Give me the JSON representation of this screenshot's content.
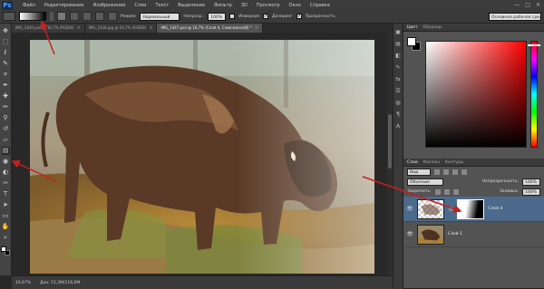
{
  "app": {
    "logo": "Ps"
  },
  "menu": [
    "Файл",
    "Редактирование",
    "Изображение",
    "Слои",
    "Текст",
    "Выделение",
    "Фильтр",
    "3D",
    "Просмотр",
    "Окно",
    "Справка"
  ],
  "window_buttons": [
    "—",
    "□",
    "✕"
  ],
  "options_bar": {
    "mode_label": "Режим:",
    "mode_value": "Нормальный",
    "opacity_label": "Непрозр.:",
    "opacity_value": "100%",
    "invert_label": "Инверсия",
    "dither_label": "Дизеринг",
    "transparency_label": "Прозрачность",
    "workspace": "Основная рабочая среда"
  },
  "tabs": [
    {
      "label": "IMG_1440.psd @ 16,7% (RGB/8)",
      "active": false
    },
    {
      "label": "IMG_1438.jpg @ 16,7% (RGB/8)",
      "active": false
    },
    {
      "label": "IMG_1447.psd @ 16,7% (Слой 4, Слой-маска/8) *",
      "active": true
    }
  ],
  "tools": [
    "move-icon",
    "marquee-icon",
    "lasso-icon",
    "quick-select-icon",
    "crop-icon",
    "eyedropper-icon",
    "healing-icon",
    "brush-icon",
    "stamp-icon",
    "history-brush-icon",
    "eraser-icon",
    "gradient-icon",
    "blur-icon",
    "dodge-icon",
    "pen-icon",
    "type-icon",
    "path-select-icon",
    "rectangle-icon",
    "hand-icon",
    "zoom-icon"
  ],
  "tool_glyphs": [
    "✥",
    "⬚",
    "ℓ",
    "✎",
    "⌗",
    "✒",
    "✚",
    "✏",
    "⚲",
    "↺",
    "▱",
    "▤",
    "◉",
    "◐",
    "✑",
    "T",
    "➤",
    "▭",
    "✋",
    "⌕"
  ],
  "status": {
    "zoom": "16,67%",
    "doc": "Док: 51,3M/116,0M"
  },
  "panel_icons": [
    "▣",
    "▤",
    "◧",
    "✎",
    "⇆",
    "☰",
    "◍",
    "¶",
    "A"
  ],
  "color_panel": {
    "tabs": [
      "Цвет",
      "Образцы"
    ]
  },
  "layers_panel": {
    "tabs": [
      "Слои",
      "Каналы",
      "Контуры"
    ],
    "kind_label": "Вид",
    "blend_mode": "Обычные",
    "opacity_label": "Непрозрачность:",
    "opacity_value": "100%",
    "lock_label": "Закрепить:",
    "fill_label": "Заливка:",
    "fill_value": "100%",
    "layers": [
      {
        "name": "Слой 4",
        "selected": true,
        "has_mask": true
      },
      {
        "name": "Слой 1",
        "selected": false,
        "has_mask": false
      }
    ],
    "footer_icons": [
      "⚭",
      "fx",
      "◐",
      "◔",
      "▭",
      "⊞",
      "🗑"
    ]
  },
  "colors": {
    "accent_arrow": "#c8201e",
    "selected_layer": "#4b6a8c"
  }
}
